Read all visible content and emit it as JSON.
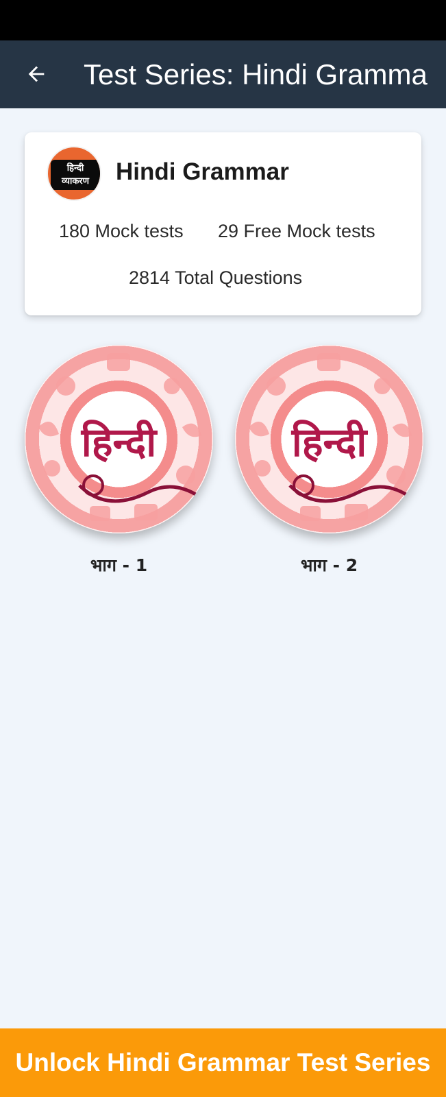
{
  "app_bar": {
    "title": "Test Series: Hindi Gramma"
  },
  "summary": {
    "logo_text_line1": "हिन्दी",
    "logo_text_line2": "व्याकरण",
    "title": "Hindi Grammar",
    "mock_tests": "180 Mock tests",
    "free_mock_tests": "29 Free Mock tests",
    "total_questions": "2814 Total Questions"
  },
  "series": [
    {
      "label": "भाग - 1",
      "image_text": "हिन्दी"
    },
    {
      "label": "भाग - 2",
      "image_text": "हिन्दी"
    }
  ],
  "unlock": {
    "label": "Unlock Hindi Grammar Test Series"
  },
  "colors": {
    "app_bar": "#263545",
    "background": "#f0f5fb",
    "unlock_bar": "#fb9a09",
    "accent_pink": "#f48c8c",
    "hindi_text": "#b0184a"
  },
  "icons": {
    "back": "arrow-left-icon"
  }
}
